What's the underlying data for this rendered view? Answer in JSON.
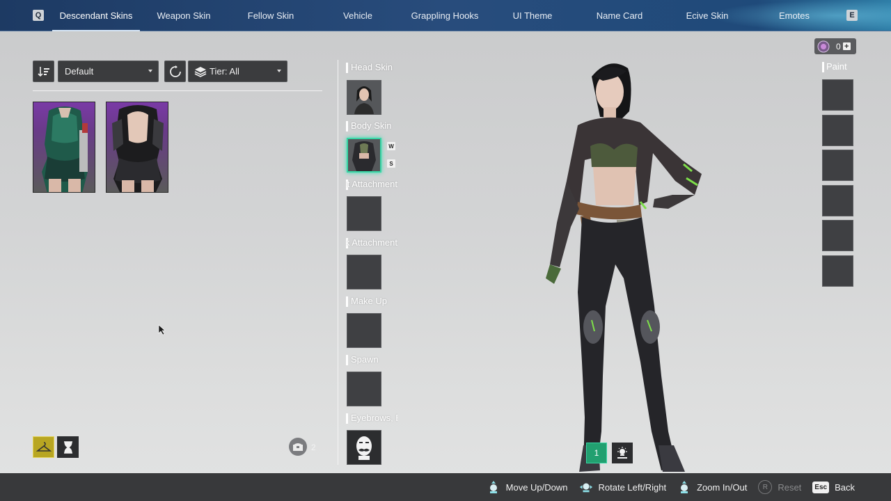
{
  "tabs": {
    "prev_key": "Q",
    "next_key": "E",
    "items": [
      {
        "label": "Descendant Skins"
      },
      {
        "label": "Weapon Skin"
      },
      {
        "label": "Fellow Skin"
      },
      {
        "label": "Vehicle"
      },
      {
        "label": "Grappling Hooks"
      },
      {
        "label": "UI Theme"
      },
      {
        "label": "Name Card"
      },
      {
        "label": "Ecive Skin"
      },
      {
        "label": "Emotes"
      }
    ],
    "active_index": 0
  },
  "filters": {
    "sort_value": "Default",
    "tier_value": "Tier: All"
  },
  "skins": [
    {
      "name": "green-uniform-skin",
      "bg_color": "#7a3aa6"
    },
    {
      "name": "black-maid-skin",
      "bg_color": "#7a3aa6"
    }
  ],
  "slots": {
    "head_skin": "Head Skin",
    "body_skin": "Body Skin",
    "front_attachment": "Front Attachment",
    "back_attachment": "Back Attachment",
    "make_up": "Make Up",
    "spawn": "Spawn",
    "eyebrows": "Eyebrows, Beard",
    "body_badge_w": "W",
    "body_badge_s": "S"
  },
  "paint": {
    "label": "Paint"
  },
  "currency": {
    "amount": "0",
    "plus": "+"
  },
  "inventory": {
    "count": "2"
  },
  "view_controls": {
    "preset_number": "1"
  },
  "bottom_hints": {
    "move": "Move Up/Down",
    "rotate": "Rotate Left/Right",
    "zoom": "Zoom In/Out",
    "reset_key": "R",
    "reset": "Reset",
    "back_key": "Esc",
    "back": "Back"
  },
  "colors": {
    "accent": "#39d6a6",
    "topbar": "#284c7c",
    "mode_active": "#b8a622"
  }
}
